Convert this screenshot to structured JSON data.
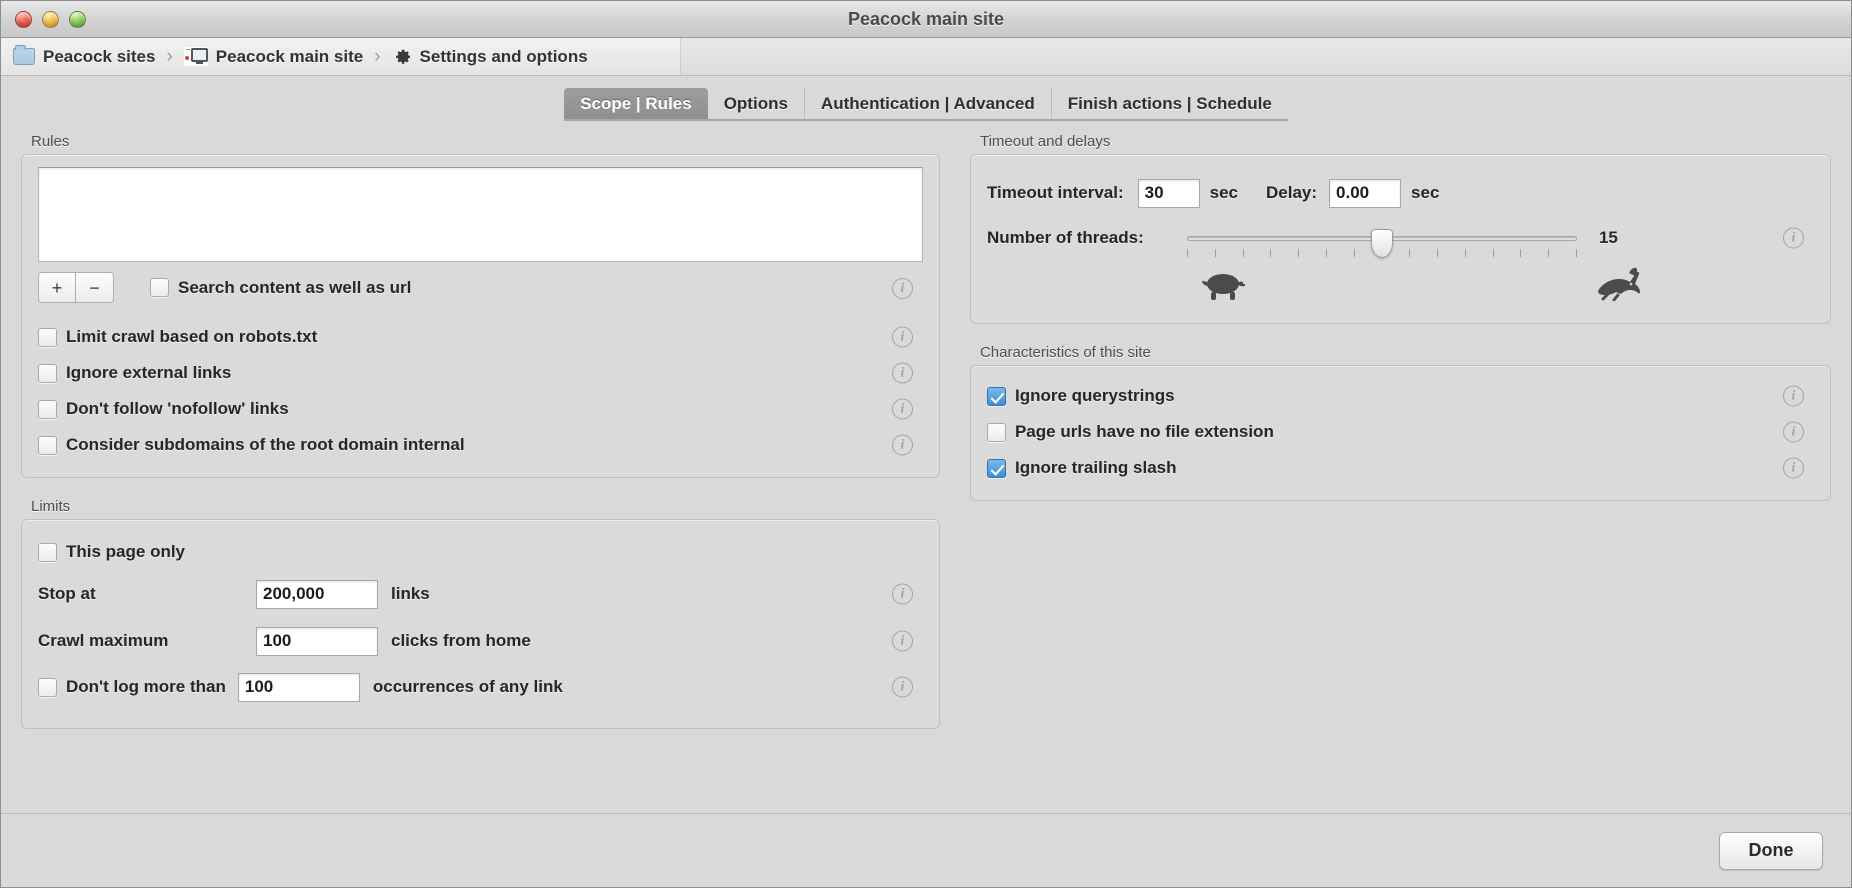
{
  "window": {
    "title": "Peacock main site",
    "traffic_lights": [
      "close-button",
      "minimize-button",
      "zoom-button"
    ]
  },
  "breadcrumb": {
    "items": [
      {
        "label": "Peacock sites",
        "icon": "folder-icon"
      },
      {
        "label": "Peacock main site",
        "icon": "monitor-icon"
      },
      {
        "label": "Settings and options",
        "icon": "gear-icon"
      }
    ],
    "separator": "›"
  },
  "tabs": [
    {
      "label": "Scope | Rules",
      "active": true
    },
    {
      "label": "Options",
      "active": false
    },
    {
      "label": "Authentication | Advanced",
      "active": false
    },
    {
      "label": "Finish actions | Schedule",
      "active": false
    }
  ],
  "rules": {
    "group_title": "Rules",
    "list_value": "",
    "add_button": "+",
    "remove_button": "−",
    "search_content_checkbox": {
      "label": "Search content as well as url",
      "checked": false
    },
    "options": [
      {
        "label": "Limit crawl based on robots.txt",
        "checked": false
      },
      {
        "label": "Ignore external links",
        "checked": false
      },
      {
        "label": "Don't follow 'nofollow' links",
        "checked": false
      },
      {
        "label": "Consider subdomains of the root domain internal",
        "checked": false
      }
    ],
    "info_glyph": "i"
  },
  "limits": {
    "group_title": "Limits",
    "this_page_only": {
      "label": "This page only",
      "checked": false
    },
    "stop_at": {
      "label": "Stop at",
      "value": "200,000",
      "suffix": "links"
    },
    "crawl_maximum": {
      "label": "Crawl maximum",
      "value": "100",
      "suffix": "clicks from home"
    },
    "dont_log": {
      "label": "Don't log more than",
      "value": "100",
      "suffix": "occurrences of any link",
      "checked": false
    }
  },
  "timeout": {
    "group_title": "Timeout and delays",
    "timeout_interval": {
      "label": "Timeout interval:",
      "value": "30",
      "unit": "sec"
    },
    "delay": {
      "label": "Delay:",
      "value": "0.00",
      "unit": "sec"
    },
    "threads": {
      "label": "Number of threads:",
      "value": "15",
      "min": 1,
      "max": 30,
      "tick_count": 15,
      "slow_icon": "turtle-icon",
      "fast_icon": "rabbit-icon"
    }
  },
  "characteristics": {
    "group_title": "Characteristics of this site",
    "items": [
      {
        "label": "Ignore querystrings",
        "checked": true
      },
      {
        "label": "Page urls have no file extension",
        "checked": false
      },
      {
        "label": "Ignore trailing slash",
        "checked": true
      }
    ]
  },
  "footer": {
    "done_label": "Done"
  },
  "colors": {
    "checkbox_accent": "#3f8fd8",
    "active_tab": "#949494",
    "window_bg": "#d9d9d9"
  }
}
